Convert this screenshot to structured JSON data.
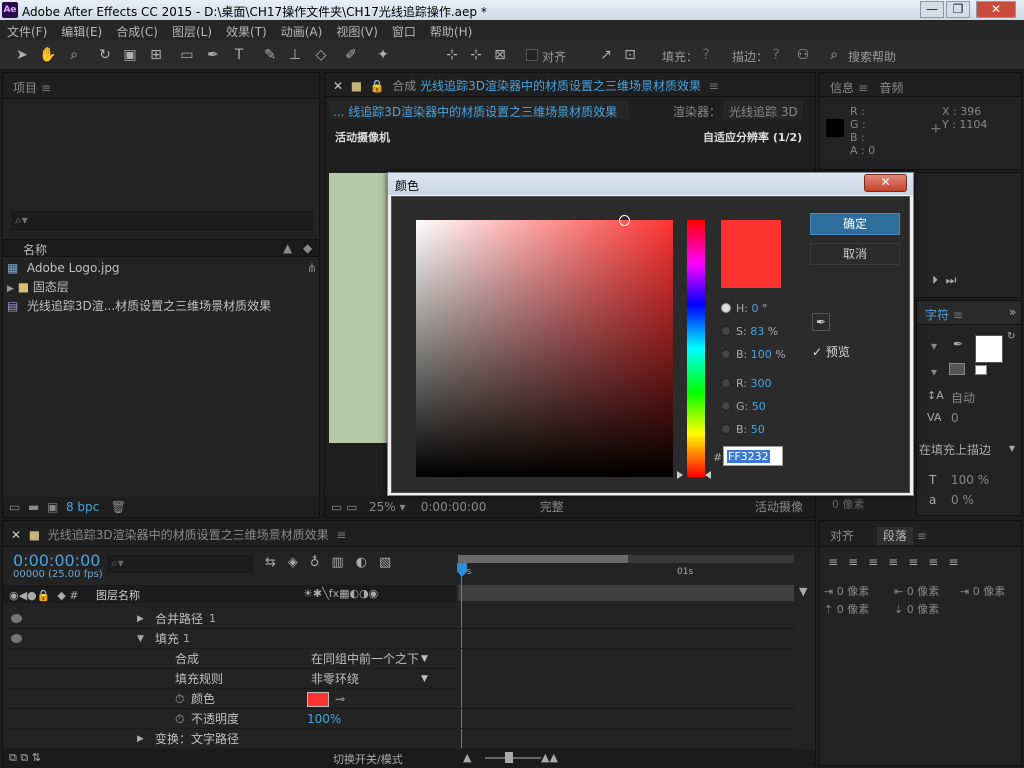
{
  "app": {
    "title": "Adobe After Effects CC 2015 - D:\\桌面\\CH17操作文件夹\\CH17光线追踪操作.aep *",
    "icon_text": "Ae",
    "window_controls": [
      "minimize-icon",
      "restore-icon",
      "close-icon"
    ]
  },
  "menu": [
    "文件(F)",
    "编辑(E)",
    "合成(C)",
    "图层(L)",
    "效果(T)",
    "动画(A)",
    "视图(V)",
    "窗口",
    "帮助(H)"
  ],
  "toolbar": {
    "align_label": "对齐",
    "fill_label": "填充：",
    "stroke_label": "描边：",
    "search_placeholder": "搜索帮助"
  },
  "project": {
    "tab": "项目",
    "name_header": "名称",
    "items": [
      {
        "label": "Adobe Logo.jpg",
        "icon": "image-icon"
      },
      {
        "label": "固态层",
        "icon": "folder-icon"
      },
      {
        "label": "光线追踪3D渲...材质设置之三维场景材质效果",
        "icon": "composition-icon"
      }
    ],
    "bpc": "8 bpc"
  },
  "composition": {
    "tab_label": "合成",
    "tab_name": "光线追踪3D渲染器中的材质设置之三维场景材质效果",
    "breadcrumb": "... 线追踪3D渲染器中的材质设置之三维场景材质效果",
    "renderer_label": "渲染器：",
    "renderer_value": "光线追踪 3D",
    "camera_label": "活动摄像机",
    "resolution_label": "自适应分辨率 (1/2)",
    "zoom": "25%",
    "timecode": "0:00:00:00",
    "quality": "完整",
    "view": "活动摄像"
  },
  "info": {
    "tab_info": "信息",
    "tab_audio": "音频",
    "r": "R :",
    "g": "G :",
    "b": "B :",
    "a": "A : 0",
    "x": "X : 396",
    "y": "Y : 1104"
  },
  "character": {
    "tab": "字符",
    "leading": "自动",
    "tracking": "0",
    "stroke_option": "在填充上描边",
    "vscale": "100 %",
    "baseline": "0 %",
    "tsume": "0 像素"
  },
  "paragraph": {
    "tab_align": "对齐",
    "tab_para": "段落",
    "indent_left": "0 像素",
    "indent_right": "0 像素",
    "indent_first": "0 像素",
    "space_before": "0 像素",
    "space_after": "0 像素"
  },
  "color_dialog": {
    "title": "颜色",
    "ok_label": "确定",
    "cancel_label": "取消",
    "preview_label": "预览",
    "preview_checked": true,
    "h_label": "H:",
    "h_value": "0",
    "h_unit": "°",
    "s_label": "S:",
    "s_value": "83",
    "s_unit": "%",
    "bri_label": "B:",
    "bri_value": "100",
    "bri_unit": "%",
    "r_label": "R:",
    "r_value": "300",
    "g_label": "G:",
    "g_value": "50",
    "b_label": "B:",
    "b_value": "50",
    "hex_prefix": "#",
    "hex_value": "FF3232",
    "selected_color": "#ff3232",
    "selected_mode": "H"
  },
  "timeline": {
    "tab": "光线追踪3D渲染器中的材质设置之三维场景材质效果",
    "timecode": "0:00:00:00",
    "frames": "00000 (25.00 fps)",
    "layer_name_header": "图层名称",
    "ruler_start": "0s",
    "ruler_01s": "01s",
    "layers": [
      {
        "label": "合并路径",
        "num": "1",
        "indent": 1,
        "twirl": "right"
      },
      {
        "label": "填充",
        "num": "1",
        "indent": 1,
        "twirl": "down"
      },
      {
        "label": "合成",
        "value": "在同组中前一个之下",
        "indent": 2
      },
      {
        "label": "填充规则",
        "value": "非零环绕",
        "indent": 2
      },
      {
        "label": "颜色",
        "indent": 2,
        "stopwatch": true
      },
      {
        "label": "不透明度",
        "value": "100%",
        "indent": 2,
        "stopwatch": true
      },
      {
        "label": "变换：文字路径",
        "indent": 1,
        "twirl": "right"
      }
    ],
    "toggle_label": "切换开关/模式",
    "layer_color": "#ff3232"
  }
}
